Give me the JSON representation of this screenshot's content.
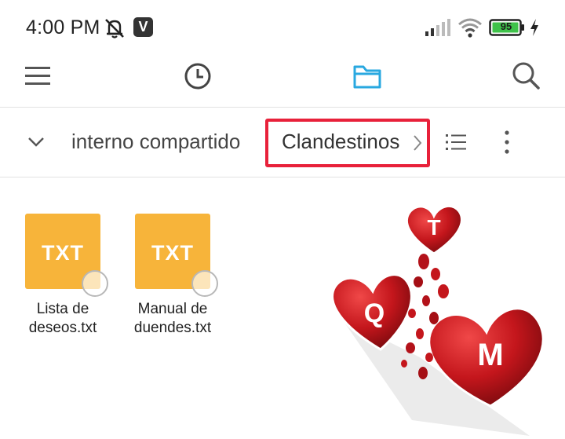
{
  "status_bar": {
    "time": "4:00 PM",
    "badge": "V",
    "battery_level": "95"
  },
  "toolbar": {
    "icons": [
      "menu-icon",
      "clock-icon",
      "folder-icon",
      "search-icon"
    ],
    "accent_color": "#29a8e0"
  },
  "path": {
    "crumbs": [
      "interno compartido",
      "Clandestinos"
    ],
    "highlight_color": "#e8213a"
  },
  "files": [
    {
      "type": "TXT",
      "name_line1": "Lista de",
      "name_line2": "deseos.txt"
    },
    {
      "type": "TXT",
      "name_line1": "Manual de",
      "name_line2": "duendes.txt"
    }
  ],
  "decoration": {
    "letters": [
      "T",
      "Q",
      "M"
    ],
    "heart_color": "#c4161c"
  }
}
